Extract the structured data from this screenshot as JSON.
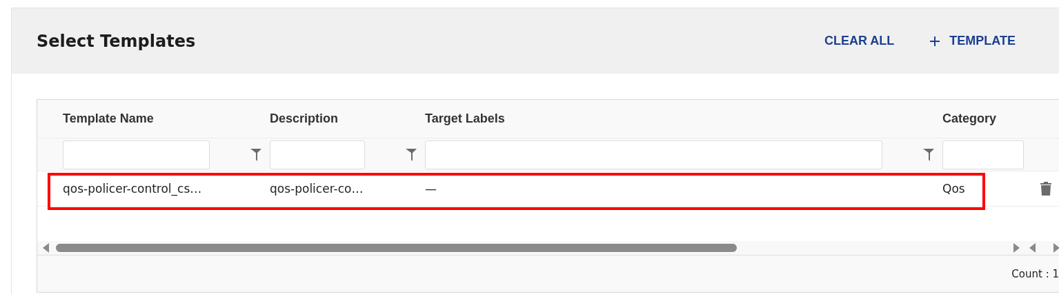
{
  "header": {
    "title": "Select Templates",
    "actions": [
      {
        "kind": "text",
        "label": "CLEAR ALL"
      },
      {
        "kind": "add",
        "label": "TEMPLATE"
      }
    ]
  },
  "table": {
    "columns": [
      {
        "label": "Template Name",
        "kind": "filtered"
      },
      {
        "label": "Description",
        "kind": "filtered"
      },
      {
        "label": "Target Labels",
        "kind": "filtered"
      },
      {
        "label": "Category",
        "kind": "plain"
      }
    ],
    "rows": [
      {
        "cells": [
          "qos-policer-control_cs…",
          "qos-policer-co…",
          "—",
          "Qos"
        ],
        "highlighted": true
      }
    ],
    "footer": "Count : 1"
  }
}
